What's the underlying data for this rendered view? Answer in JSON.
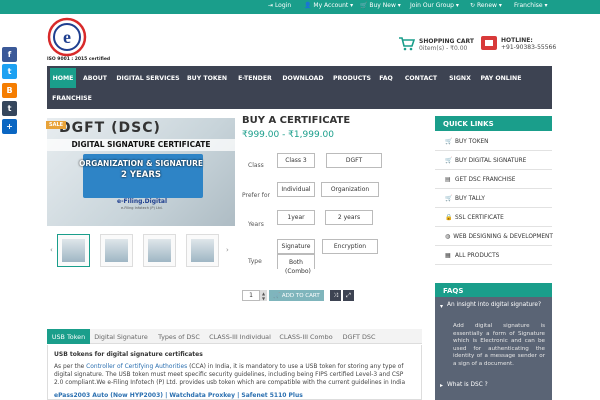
{
  "topbar": {
    "items": [
      {
        "icon": "login-icon",
        "label": "Login"
      },
      {
        "icon": "user-icon",
        "label": "My Account"
      },
      {
        "icon": "cart-icon",
        "label": "Buy New"
      },
      {
        "label": "Join Our Group"
      },
      {
        "icon": "refresh-icon",
        "label": "Renew"
      },
      {
        "label": "Franchise"
      }
    ]
  },
  "header": {
    "logo_caption": "ISO 9001 : 2015 certified",
    "cart_title": "SHOPPING CART",
    "cart_summary": "0item(s) - ₹0.00",
    "hotline_title": "HOTLINE:",
    "hotline_number": "+91-90383-55566"
  },
  "nav": {
    "items": [
      "HOME",
      "ABOUT",
      "DIGITAL SERVICES",
      "BUY TOKEN",
      "E-TENDER",
      "DOWNLOAD",
      "PRODUCTS",
      "FAQ",
      "CONTACT",
      "SIGNX",
      "PAY ONLINE",
      "FRANCHISE"
    ],
    "active": "HOME"
  },
  "share": [
    {
      "icon": "facebook-icon",
      "glyph": "f",
      "color": "#3b5998"
    },
    {
      "icon": "twitter-icon",
      "glyph": "t",
      "color": "#1da1f2"
    },
    {
      "icon": "blogger-icon",
      "glyph": "B",
      "color": "#f57d00"
    },
    {
      "icon": "tumblr-icon",
      "glyph": "t",
      "color": "#35465c"
    },
    {
      "icon": "share-plus-icon",
      "glyph": "+",
      "color": "#0a66c2"
    }
  ],
  "product_image": {
    "sale_badge": "SALE",
    "title_line": "DGFT (DSC)",
    "line2": "DIGITAL SIGNATURE CERTIFICATE",
    "line3": "ORGANIZATION & SIGNATURE",
    "line4": "2 YEARS",
    "brand": "e-Filing.Digital",
    "brand_sub": "e-Filing Infotech (P) Ltd.",
    "thumb_prev": "‹",
    "thumb_next": "›"
  },
  "product": {
    "title": "BUY A CERTIFICATE",
    "price": "₹999.00 - ₹1,999.00",
    "options": [
      {
        "label": "Class",
        "values": [
          "Class 3",
          "DGFT"
        ]
      },
      {
        "label": "Prefer for",
        "values": [
          "Individual",
          "Organization"
        ]
      },
      {
        "label": "Years",
        "values": [
          "1year",
          "2 years"
        ]
      },
      {
        "label": "Type",
        "values": [
          "Signature",
          "Encryption",
          "Both",
          "(Combo)"
        ]
      }
    ],
    "quantity": "1",
    "add_to_cart": "ADD TO CART",
    "shuffle_icon": "⤨",
    "expand_icon": "⤢"
  },
  "tabs": {
    "items": [
      "USB Token",
      "Digital Signature",
      "Types of DSC",
      "CLASS-III Individual",
      "CLASS-III Combo",
      "DGFT DSC"
    ],
    "active": "USB Token"
  },
  "description": {
    "heading": "USB tokens for digital signature certificates",
    "p_before": "As per the ",
    "p_link": "Controller of Certifying Authorities",
    "p_after": " (CCA) in India, it is mandatory to use a USB token for storing any type of digital signature. The USB token must meet specific security guidelines, including being FIPS certified Level-3 and CSP 2.0 compliant.We e-Filing Infotech (P) Ltd. provides usb token which are compatible with the current guidelines in India",
    "models": "ePass2003 Auto (Now HYP2003) | Watchdata Proxkey | Safenet 5110 Plus"
  },
  "sidebar": {
    "quick_links_title": "QUICK LINKS",
    "links": [
      {
        "icon": "cart-icon",
        "glyph": "🛒",
        "label": "BUY TOKEN"
      },
      {
        "icon": "cart-icon",
        "glyph": "🛒",
        "label": "BUY DIGITAL SIGNATURE"
      },
      {
        "icon": "store-icon",
        "glyph": "▤",
        "label": "GET DSC FRANCHISE"
      },
      {
        "icon": "cart-icon",
        "glyph": "🛒",
        "label": "BUY TALLY"
      },
      {
        "icon": "lock-icon",
        "glyph": "🔒",
        "label": "SSL CERTIFICATE"
      },
      {
        "icon": "globe-icon",
        "glyph": "◍",
        "label": "WEB DESIGNING & DEVELOPMENT"
      },
      {
        "icon": "grid-icon",
        "glyph": "▦",
        "label": "ALL PRODUCTS"
      }
    ],
    "faq_title": "FAQS",
    "faq_q1": "An insight into digital signature?",
    "faq_a1": "Add digital signature is essentially a form of Signature which is Electronic and can be used for authenticating the identity of a message sender or a sign of a document.",
    "faq_q2": "What is DSC ?"
  },
  "colors": {
    "accent": "#1a9e8b",
    "nav_bg": "#3d4352",
    "faq_bg": "#5a6475",
    "price": "#1a9e8b"
  }
}
